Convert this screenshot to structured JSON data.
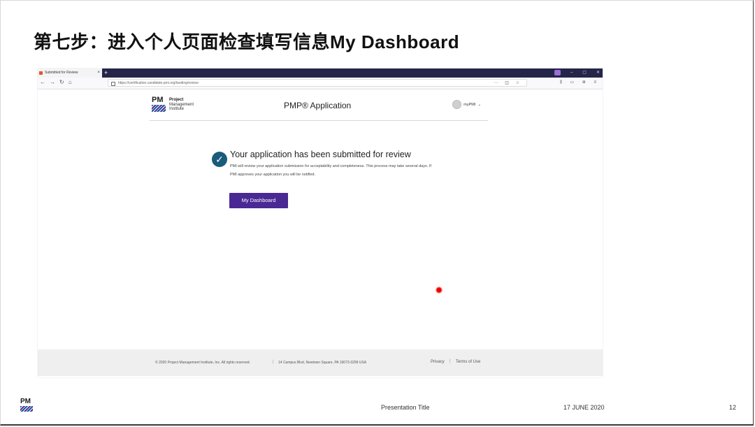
{
  "slide": {
    "title": "第七步：进入个人页面检查填写信息My Dashboard",
    "footer_title": "Presentation Title",
    "footer_date": "17 JUNE 2020",
    "page_number": "12"
  },
  "browser": {
    "tab_title": "Submitted for Review",
    "new_tab": "+",
    "url": "https://certification.candidate.pmi.org/landing/review",
    "nav_icons": [
      "back-icon",
      "forward-icon",
      "reload-icon",
      "home-icon"
    ]
  },
  "page": {
    "logo_text": [
      "Project",
      "Management",
      "Institute"
    ],
    "app_title": "PMP® Application",
    "account_label": "myPMI",
    "message_title": "Your application has been submitted for review",
    "message_body": "PMI will review your application submission for acceptability and completeness. This process may take several days. If PMI approves your application you will be notified.",
    "dashboard_button": "My Dashboard",
    "footer": {
      "copyright": "© 2020 Project Management Institute, Inc. All rights reserved.",
      "address": "14 Campus Blvd, Newtown Square, PA 19073-3299 USA",
      "privacy": "Privacy",
      "terms": "Terms of Use"
    }
  },
  "colors": {
    "accent_purple": "#4a2994",
    "check_teal": "#1a5a7a",
    "browser_dark": "#25254a"
  }
}
